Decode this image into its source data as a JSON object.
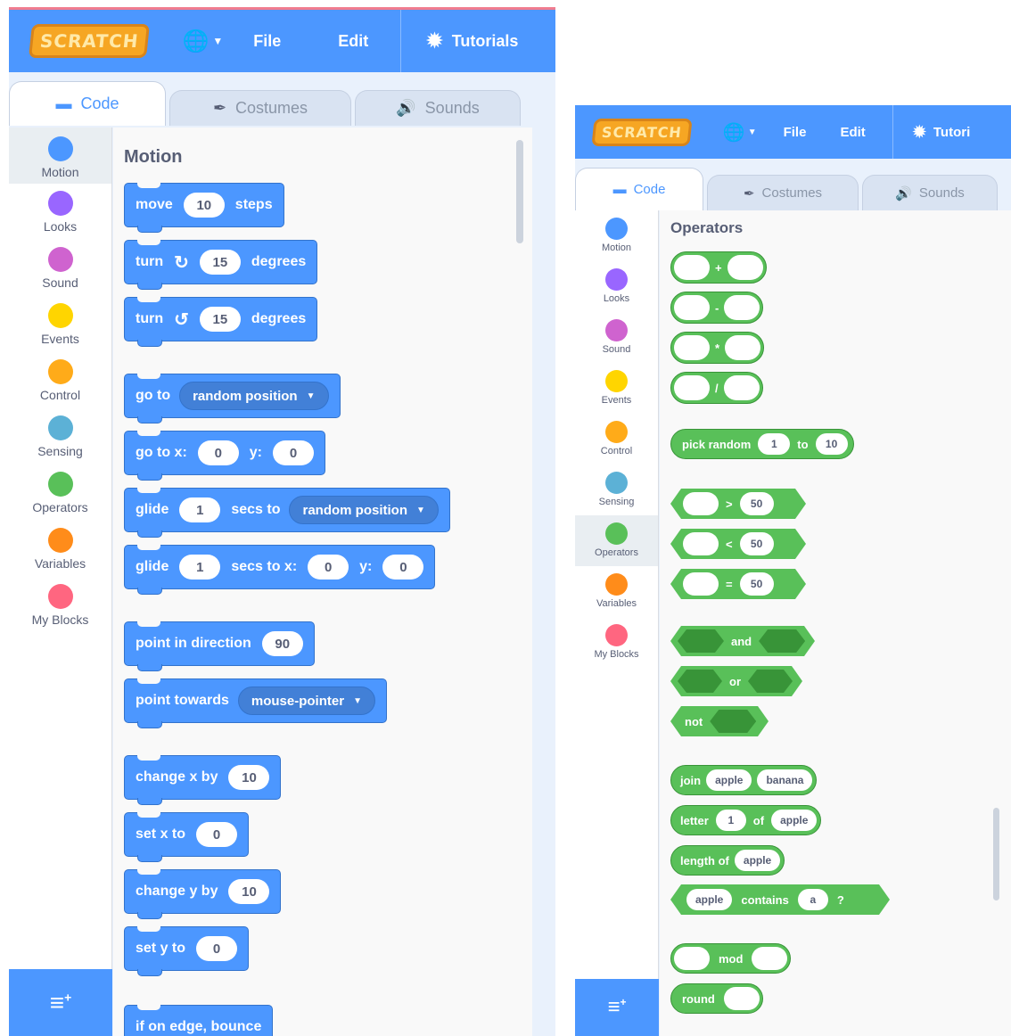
{
  "left": {
    "menu": {
      "logo": "SCRATCH",
      "file": "File",
      "edit": "Edit",
      "tutorials": "Tutorials"
    },
    "tabs": {
      "code": "Code",
      "costumes": "Costumes",
      "sounds": "Sounds"
    },
    "categories": [
      {
        "label": "Motion",
        "color": "#4c97ff"
      },
      {
        "label": "Looks",
        "color": "#9966ff"
      },
      {
        "label": "Sound",
        "color": "#cf63cf"
      },
      {
        "label": "Events",
        "color": "#ffd500"
      },
      {
        "label": "Control",
        "color": "#ffab19"
      },
      {
        "label": "Sensing",
        "color": "#5cb1d6"
      },
      {
        "label": "Operators",
        "color": "#59c059"
      },
      {
        "label": "Variables",
        "color": "#ff8c1a"
      },
      {
        "label": "My Blocks",
        "color": "#ff6680"
      }
    ],
    "palette_title": "Motion",
    "blocks": {
      "move": {
        "a": "move",
        "v": "10",
        "b": "steps"
      },
      "turn_cw": {
        "a": "turn",
        "v": "15",
        "b": "degrees"
      },
      "turn_ccw": {
        "a": "turn",
        "v": "15",
        "b": "degrees"
      },
      "goto": {
        "a": "go to",
        "dd": "random position"
      },
      "gotoxy": {
        "a": "go to x:",
        "x": "0",
        "y_label": "y:",
        "y": "0"
      },
      "glide_to": {
        "a": "glide",
        "v": "1",
        "b": "secs to",
        "dd": "random position"
      },
      "glide_xy": {
        "a": "glide",
        "v": "1",
        "b": "secs to x:",
        "x": "0",
        "y_label": "y:",
        "y": "0"
      },
      "point_dir": {
        "a": "point in direction",
        "v": "90"
      },
      "point_towards": {
        "a": "point towards",
        "dd": "mouse-pointer"
      },
      "change_x": {
        "a": "change x by",
        "v": "10"
      },
      "set_x": {
        "a": "set x to",
        "v": "0"
      },
      "change_y": {
        "a": "change y by",
        "v": "10"
      },
      "set_y": {
        "a": "set y to",
        "v": "0"
      },
      "bounce": {
        "a": "if on edge, bounce"
      }
    }
  },
  "right": {
    "menu": {
      "logo": "SCRATCH",
      "file": "File",
      "edit": "Edit",
      "tutorials": "Tutori"
    },
    "tabs": {
      "code": "Code",
      "costumes": "Costumes",
      "sounds": "Sounds"
    },
    "categories": [
      "Motion",
      "Looks",
      "Sound",
      "Events",
      "Control",
      "Sensing",
      "Operators",
      "Variables",
      "My Blocks"
    ],
    "palette_title": "Operators",
    "ops": {
      "plus": "+",
      "minus": "-",
      "times": "*",
      "divide": "/",
      "pick_random": {
        "a": "pick random",
        "v1": "1",
        "b": "to",
        "v2": "10"
      },
      "gt": {
        "op": ">",
        "v": "50"
      },
      "lt": {
        "op": "<",
        "v": "50"
      },
      "eq": {
        "op": "=",
        "v": "50"
      },
      "and": "and",
      "or": "or",
      "not": "not",
      "join": {
        "a": "join",
        "v1": "apple",
        "v2": "banana"
      },
      "letter": {
        "a": "letter",
        "v1": "1",
        "b": "of",
        "v2": "apple"
      },
      "length": {
        "a": "length of",
        "v": "apple"
      },
      "contains": {
        "v1": "apple",
        "a": "contains",
        "v2": "a",
        "q": "?"
      },
      "mod": "mod",
      "round": "round"
    }
  }
}
